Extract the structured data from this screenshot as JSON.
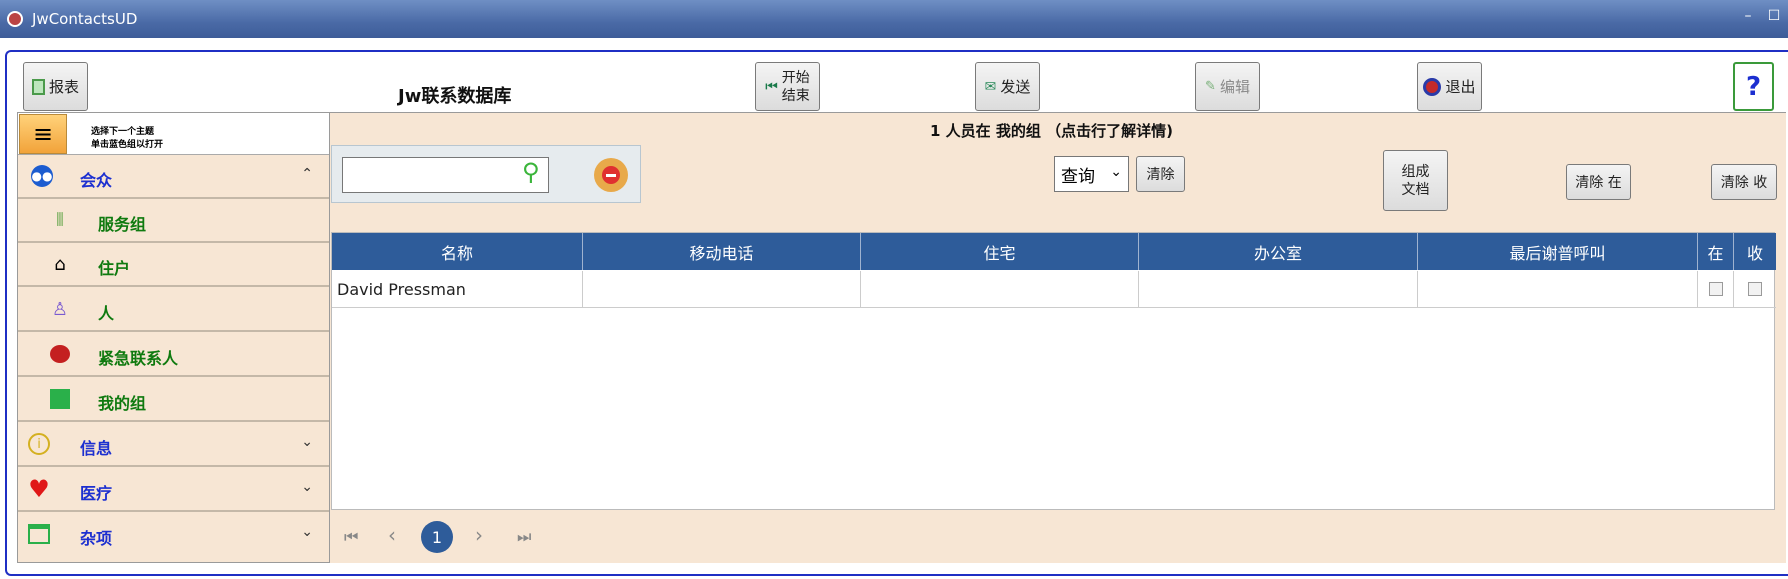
{
  "window": {
    "title": "JwContactsUD",
    "minimize": "–",
    "maximize": "☐"
  },
  "toolbar": {
    "report": "报表",
    "start_end_line1": "开始",
    "start_end_line2": "结束",
    "send": "发送",
    "edit": "编辑",
    "exit": "退出",
    "help": "?"
  },
  "app_title": "Jw联系数据库",
  "sidebar": {
    "hint_line1": "选择下一个主题",
    "hint_line2": "单击蓝色组以打开",
    "items": [
      {
        "label": "会众",
        "icon": "congregation-icon",
        "expanded": true
      },
      {
        "label": "服务组",
        "icon": "service-group-icon"
      },
      {
        "label": "住户",
        "icon": "household-icon"
      },
      {
        "label": "人",
        "icon": "person-icon"
      },
      {
        "label": "紧急联系人",
        "icon": "emergency-icon"
      },
      {
        "label": "我的组",
        "icon": "my-group-icon"
      },
      {
        "label": "信息",
        "icon": "info-icon",
        "expanded": false
      },
      {
        "label": "医疗",
        "icon": "heart-icon",
        "expanded": false
      },
      {
        "label": "杂项",
        "icon": "calendar-icon",
        "expanded": false
      }
    ]
  },
  "main": {
    "status": "1 人员在 我的组 （点击行了解详情)",
    "search_placeholder": "",
    "query_select": "查询",
    "clear": "清除",
    "compose_line1": "组成",
    "compose_line2": "文档",
    "clear_in": "清除 在",
    "clear_received": "清除 收"
  },
  "table": {
    "columns": [
      "名称",
      "移动电话",
      "住宅",
      "办公室",
      "最后谢普呼叫",
      "在",
      "收"
    ],
    "rows": [
      {
        "name": "David Pressman",
        "mobile": "",
        "home": "",
        "office": "",
        "last_call": "",
        "in": false,
        "received": false
      }
    ]
  },
  "pager": {
    "first": "⏮",
    "prev": "‹",
    "current": "1",
    "next": "›",
    "last": "⏭"
  },
  "colors": {
    "accent": "#2e5c9a",
    "panel": "#f7e6d4",
    "frame": "#1f2fc4"
  }
}
